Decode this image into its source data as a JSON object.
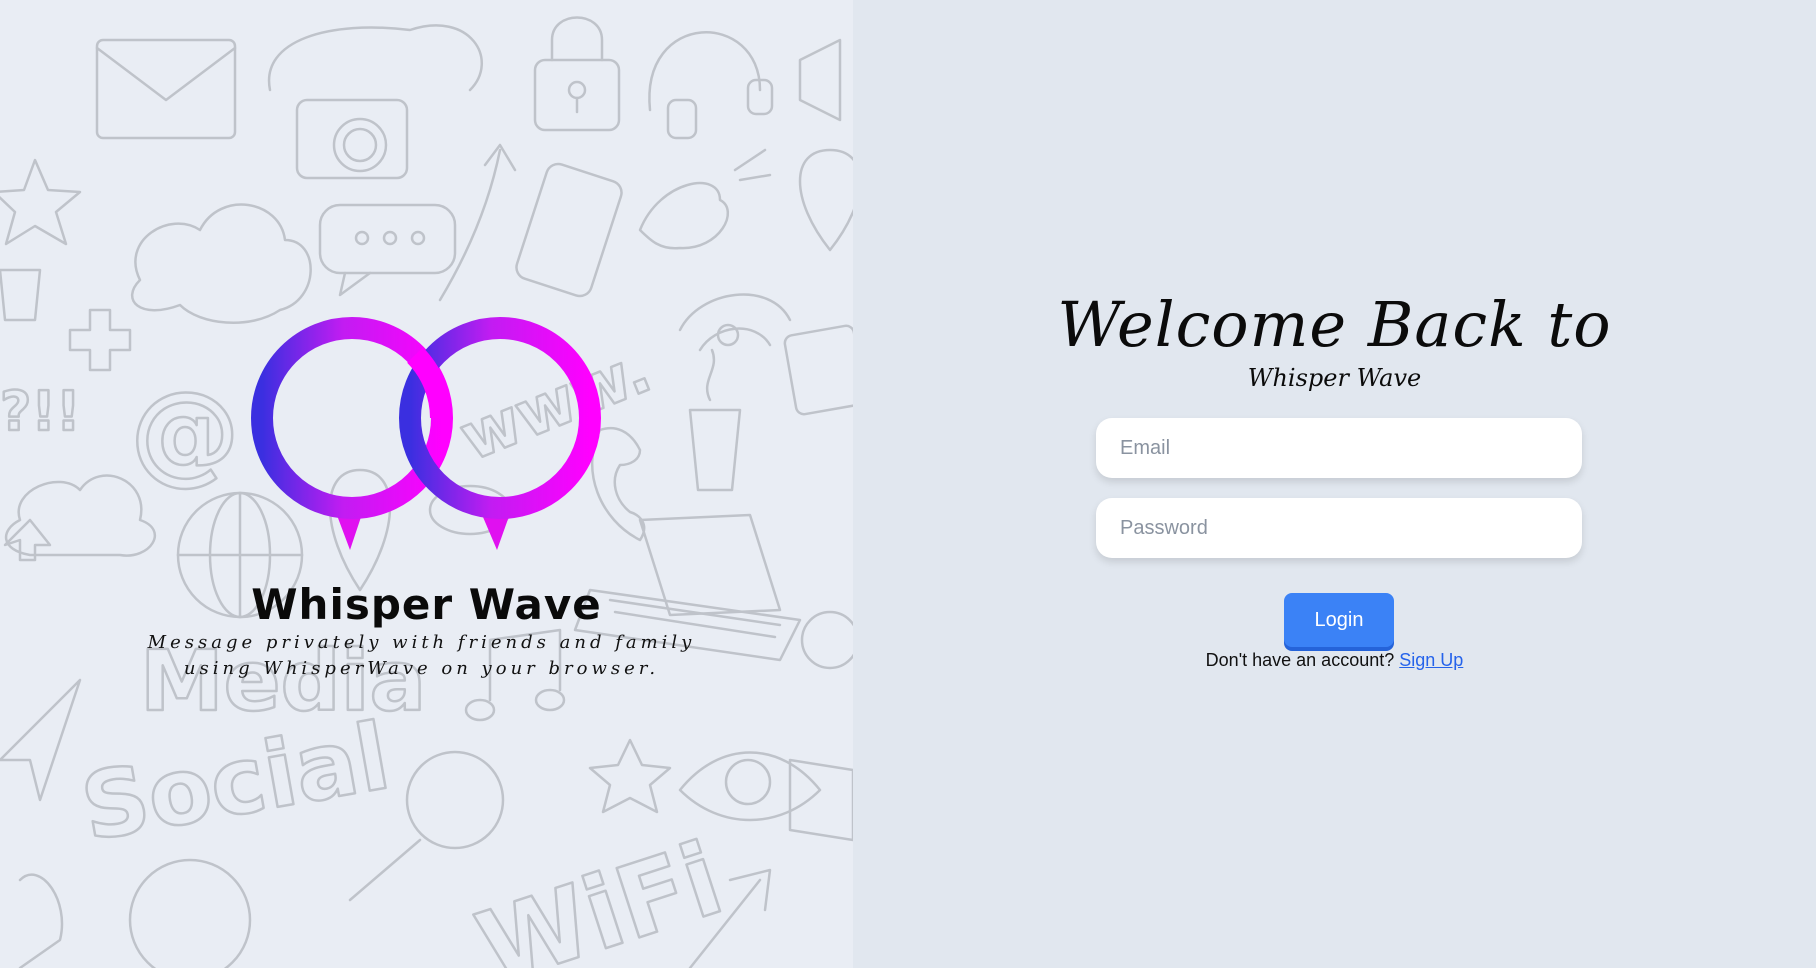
{
  "brand": {
    "name": "Whisper Wave",
    "tagline": "Message privately with friends and family using WhisperWave on your browser."
  },
  "login": {
    "heading": "Welcome Back to",
    "subheading": "Whisper Wave",
    "email_placeholder": "Email",
    "password_placeholder": "Password",
    "login_label": "Login",
    "signup_prompt": "Don't have an account?",
    "signup_link": "Sign Up"
  },
  "doodle_words": {
    "www": "www.",
    "media": "Media",
    "social": "Social",
    "wifi": "WiFi",
    "at": "@"
  },
  "colors": {
    "left_bg": "#e9edf4",
    "right_bg": "#e1e7ef",
    "accent": "#3b82f6",
    "logo_magenta": "#ff00ff",
    "logo_blue": "#3a2fe0"
  }
}
